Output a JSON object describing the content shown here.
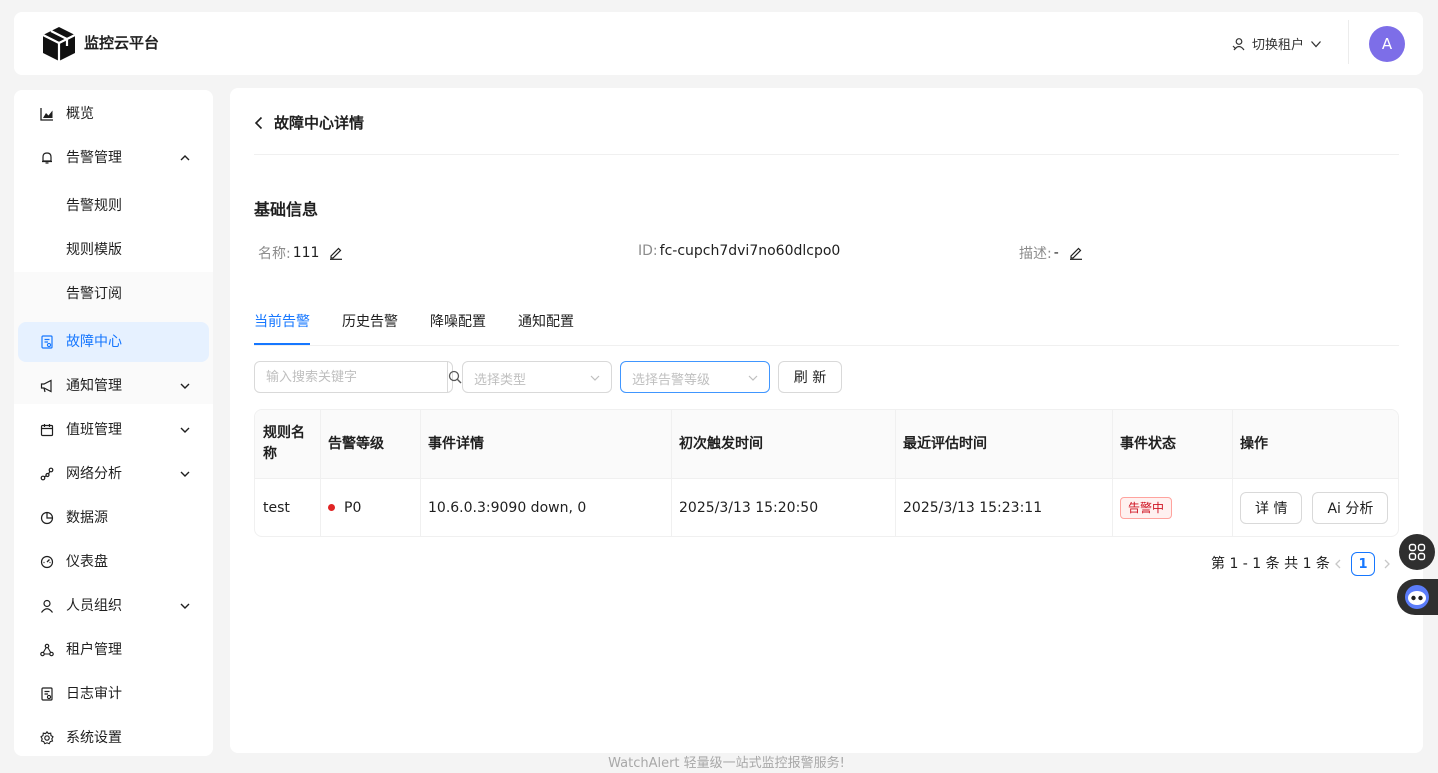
{
  "header": {
    "brand": "监控云平台",
    "switch_tenant": "切换租户",
    "avatar_initial": "A"
  },
  "sidebar": {
    "items": [
      {
        "label": "概览",
        "icon": "chart-icon"
      },
      {
        "label": "告警管理",
        "icon": "bell-icon",
        "expanded": true
      },
      {
        "label": "故障中心",
        "icon": "fault-doc-icon",
        "active": true
      },
      {
        "label": "通知管理",
        "icon": "megaphone-icon"
      },
      {
        "label": "值班管理",
        "icon": "calendar-icon"
      },
      {
        "label": "网络分析",
        "icon": "network-icon"
      },
      {
        "label": "数据源",
        "icon": "pie-icon"
      },
      {
        "label": "仪表盘",
        "icon": "dashboard-icon"
      },
      {
        "label": "人员组织",
        "icon": "user-icon"
      },
      {
        "label": "租户管理",
        "icon": "cluster-icon"
      },
      {
        "label": "日志审计",
        "icon": "audit-icon"
      },
      {
        "label": "系统设置",
        "icon": "gear-icon"
      }
    ],
    "alert_sub": [
      "告警规则",
      "规则模版",
      "告警订阅"
    ]
  },
  "page": {
    "title": "故障中心详情",
    "section_title": "基础信息",
    "info": {
      "name_label": "名称:",
      "name_value": "111",
      "id_label": "ID:",
      "id_value": "fc-cupch7dvi7no60dlcpo0",
      "desc_label": "描述:",
      "desc_value": "-"
    },
    "tabs": [
      "当前告警",
      "历史告警",
      "降噪配置",
      "通知配置"
    ],
    "active_tab": 0
  },
  "filters": {
    "search_placeholder": "输入搜索关键字",
    "type_placeholder": "选择类型",
    "level_placeholder": "选择告警等级",
    "refresh_label": "刷 新"
  },
  "table": {
    "columns": [
      "规则名称",
      "告警等级",
      "事件详情",
      "初次触发时间",
      "最近评估时间",
      "事件状态",
      "操作"
    ],
    "rows": [
      {
        "rule": "test",
        "level": "P0",
        "detail": "10.6.0.3:9090 down, 0",
        "first_time": "2025/3/13 15:20:50",
        "last_time": "2025/3/13 15:23:11",
        "status": "告警中",
        "actions": [
          "详 情",
          "Ai 分析"
        ]
      }
    ]
  },
  "pagination": {
    "total_text": "第 1 - 1 条 共 1 条",
    "current_page": "1"
  },
  "footer": "WatchAlert 轻量级一站式监控报警服务!",
  "colors": {
    "primary": "#1677ff",
    "active_bg": "#e6f1ff",
    "alert_red": "#e02424",
    "avatar": "#7d6ee8"
  }
}
